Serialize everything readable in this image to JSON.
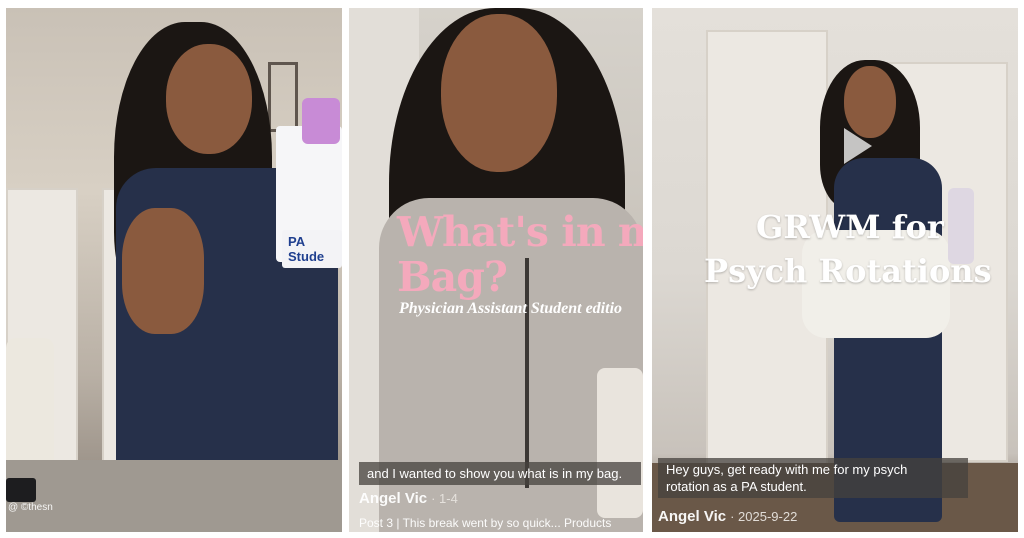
{
  "posts": [
    {
      "badge": "PA Stude",
      "watermark": "@ ©thesn"
    },
    {
      "title_line1": "What's in m",
      "title_line2": "Bag?",
      "subtitle": "Physician Assistant Student editio",
      "caption": "and I wanted to show you what is in my bag.",
      "author": "Angel Vic",
      "date": "· 1-4",
      "post_text": "Post 3 | This break went by so quick... Products"
    },
    {
      "title_line1": "GRWM for",
      "title_line2": "Psych Rotations",
      "caption_line1": "Hey guys, get ready with me for my psych",
      "caption_line2": "rotation as a PA student.",
      "author": "Angel Vic",
      "date": "· 2025-9-22"
    }
  ]
}
